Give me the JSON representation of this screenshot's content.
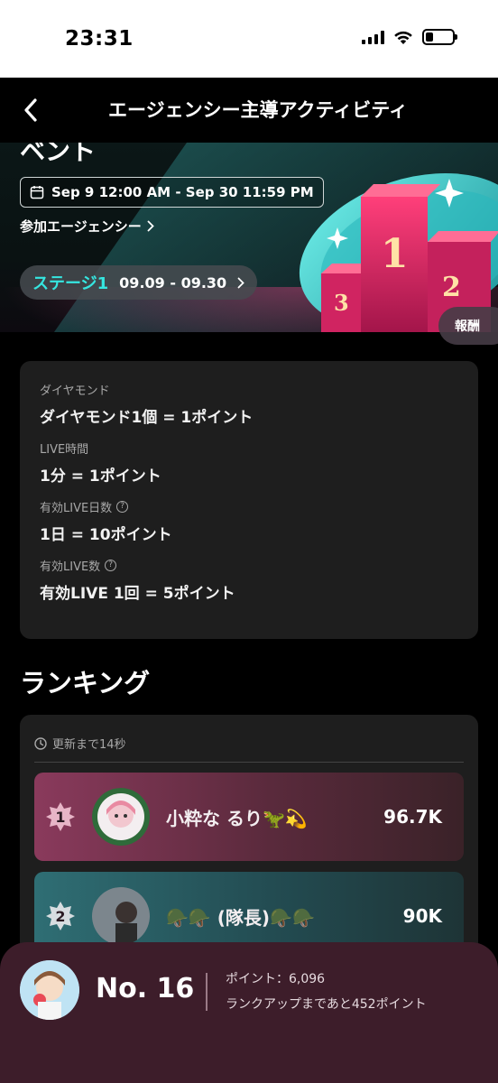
{
  "status_bar": {
    "time": "23:31",
    "battery_level": 0.3
  },
  "nav": {
    "title": "エージェンシー主導アクティビティ"
  },
  "banner": {
    "title": "ベント",
    "date_range": "Sep 9 12:00 AM - Sep 30 11:59 PM",
    "agencies_link": "参加エージェンシー",
    "stage_name": "ステージ1",
    "stage_dates": "09.09 - 09.30",
    "reward_label": "報酬",
    "podium_numbers": [
      "1",
      "2",
      "3"
    ]
  },
  "rules": [
    {
      "label": "ダイヤモンド",
      "value": "ダイヤモンド1個 = 1ポイント",
      "help": false
    },
    {
      "label": "LIVE時間",
      "value": "1分 = 1ポイント",
      "help": false
    },
    {
      "label": "有効LIVE日数",
      "value": "1日 = 10ポイント",
      "help": true
    },
    {
      "label": "有効LIVE数",
      "value": "有効LIVE 1回 = 5ポイント",
      "help": true
    }
  ],
  "ranking": {
    "title": "ランキング",
    "update_text": "更新まで14秒",
    "entries": [
      {
        "rank": "1",
        "name": "小粋な るり🦖💫",
        "points": "96.7K"
      },
      {
        "rank": "2",
        "name": "🪖🪖 (隊長)🪖🪖",
        "points": "90K"
      }
    ]
  },
  "my_rank": {
    "rank_label": "No. 16",
    "points_text": "ポイント：6,096",
    "next_text": "ランクアップまであと452ポイント"
  },
  "colors": {
    "accent_cyan": "#35e6e0",
    "rank1_bg": "#8a3a5c",
    "rank2_bg": "#2f6e74",
    "bottom_sheet": "#3d1d2a",
    "card_bg": "#1e1e1e"
  }
}
